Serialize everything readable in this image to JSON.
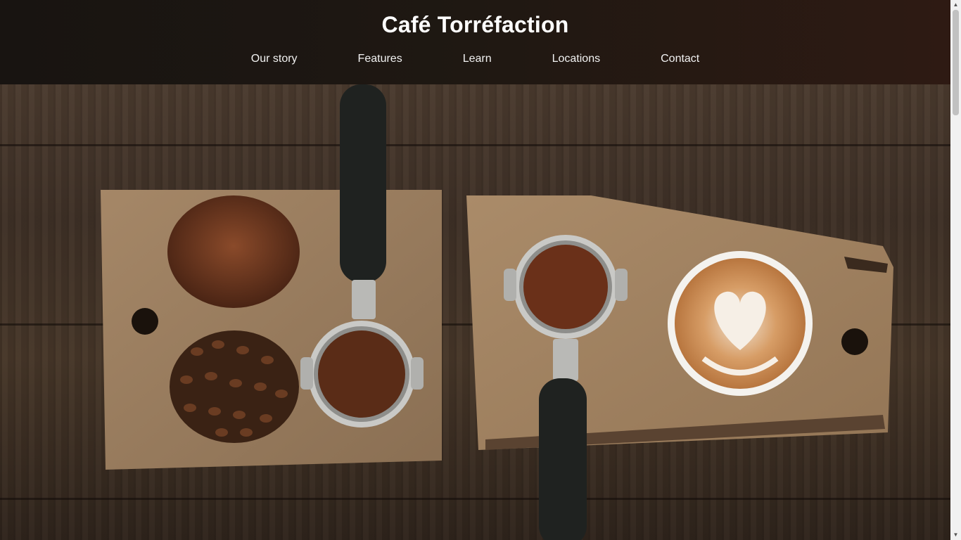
{
  "header": {
    "title": "Café Torréfaction",
    "nav": [
      "Our story",
      "Features",
      "Learn",
      "Locations",
      "Contact"
    ]
  },
  "hero": {
    "image": "coffee-boards-photo"
  },
  "colors": {
    "header_dark": "#181411",
    "header_red": "#2e1a13",
    "wood": "#a88b6a",
    "table": "#3e3026"
  }
}
